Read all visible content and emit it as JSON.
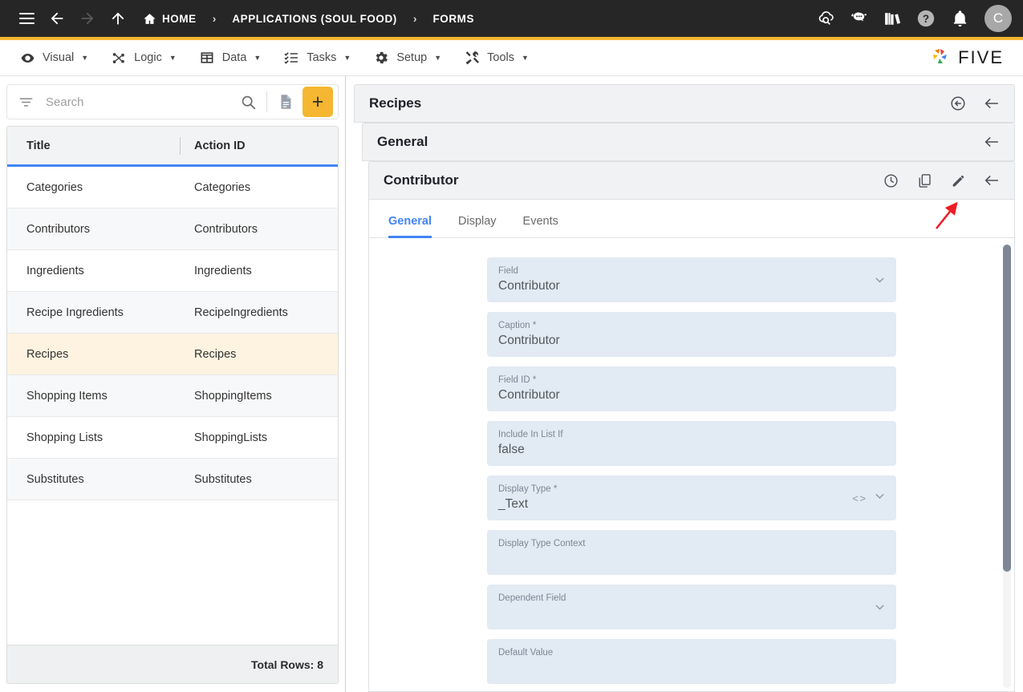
{
  "topbar": {
    "menu_icon": "hamburger-icon",
    "back_label": "back",
    "forward_label": "forward",
    "up_label": "up",
    "breadcrumbs": [
      {
        "label": "HOME",
        "icon": "home-icon"
      },
      {
        "label": "APPLICATIONS (SOUL FOOD)",
        "icon": ""
      },
      {
        "label": "FORMS",
        "icon": ""
      }
    ],
    "separator": "›",
    "right_icons": [
      {
        "name": "cloud-search-icon",
        "title": "Cloud Search"
      },
      {
        "name": "chatbot-icon",
        "title": "Assistant"
      },
      {
        "name": "library-books-icon",
        "title": "Documentation"
      },
      {
        "name": "help-icon",
        "title": "Help"
      },
      {
        "name": "notifications-bell-icon",
        "title": "Notifications"
      }
    ],
    "avatar_initial": "C"
  },
  "menubar": {
    "items": [
      {
        "label": "Visual",
        "icon": "eye-icon",
        "caret": "▼"
      },
      {
        "label": "Logic",
        "icon": "logic-nodes-icon",
        "caret": "▼"
      },
      {
        "label": "Data",
        "icon": "table-grid-icon",
        "caret": "▼"
      },
      {
        "label": "Tasks",
        "icon": "checklist-icon",
        "caret": "▼"
      },
      {
        "label": "Setup",
        "icon": "gear-icon",
        "caret": "▼"
      },
      {
        "label": "Tools",
        "icon": "tools-icon",
        "caret": "▼"
      }
    ],
    "brand": "FIVE"
  },
  "left_panel": {
    "search": {
      "placeholder": "Search",
      "value": ""
    },
    "filter_icon": "filter-icon",
    "search_icon": "search-icon",
    "doc_icon": "document-icon",
    "add_label": "+",
    "columns": [
      "Title",
      "Action ID"
    ],
    "rows": [
      {
        "title": "Categories",
        "action_id": "Categories"
      },
      {
        "title": "Contributors",
        "action_id": "Contributors"
      },
      {
        "title": "Ingredients",
        "action_id": "Ingredients"
      },
      {
        "title": "Recipe Ingredients",
        "action_id": "RecipeIngredients"
      },
      {
        "title": "Recipes",
        "action_id": "Recipes"
      },
      {
        "title": "Shopping Items",
        "action_id": "ShoppingItems"
      },
      {
        "title": "Shopping Lists",
        "action_id": "ShoppingLists"
      },
      {
        "title": "Substitutes",
        "action_id": "Substitutes"
      }
    ],
    "selected_row_index": 4,
    "footer": "Total Rows: 8"
  },
  "right_panel": {
    "panels": [
      {
        "title": "Recipes",
        "icons": [
          "revert-circle-icon",
          "collapse-arrow-icon"
        ]
      },
      {
        "title": "General",
        "icons": [
          "collapse-arrow-icon"
        ]
      },
      {
        "title": "Contributor",
        "icons": [
          "history-clock-icon",
          "copy-icon",
          "edit-pencil-icon",
          "collapse-arrow-icon"
        ]
      }
    ],
    "tabs": [
      {
        "label": "General",
        "active": true
      },
      {
        "label": "Display",
        "active": false
      },
      {
        "label": "Events",
        "active": false
      }
    ],
    "fields": [
      {
        "label": "Field",
        "value": "Contributor",
        "icons": [
          "chevron-down-icon"
        ]
      },
      {
        "label": "Caption *",
        "value": "Contributor",
        "icons": []
      },
      {
        "label": "Field ID *",
        "value": "Contributor",
        "icons": []
      },
      {
        "label": "Include In List If",
        "value": "false",
        "icons": []
      },
      {
        "label": "Display Type *",
        "value": "_Text",
        "icons": [
          "code-icon",
          "chevron-down-icon"
        ]
      },
      {
        "label": "Display Type Context",
        "value": "",
        "icons": []
      },
      {
        "label": "Dependent Field",
        "value": "",
        "icons": [
          "chevron-down-icon"
        ]
      },
      {
        "label": "Default Value",
        "value": "",
        "icons": []
      }
    ]
  },
  "annotation": {
    "type": "arrow",
    "color": "#ee1c25",
    "points_at": "edit-pencil-icon"
  },
  "colors": {
    "topbar": "#262626",
    "accent": "#f5b731",
    "tab_active": "#4285f4",
    "selected_row": "#fdf3e0",
    "field_bg": "#e2eaf3",
    "annotation": "#ee1c25"
  }
}
